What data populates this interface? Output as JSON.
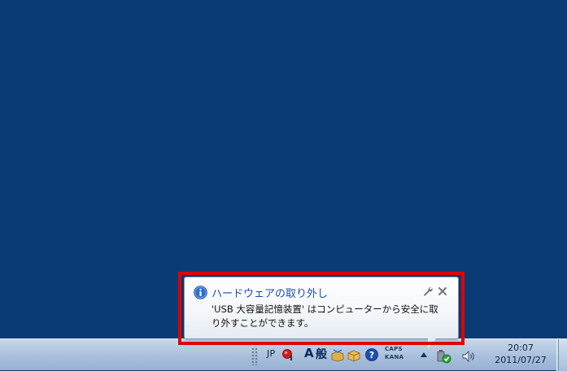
{
  "balloon": {
    "title": "ハードウェアの取り外し",
    "message": "'USB 大容量記憶装置' はコンピューターから安全に取り外すことができます。",
    "icon": "info-icon",
    "accent_color": "#1b4fb3"
  },
  "taskbar": {
    "language": "JP",
    "ime_mode": "A",
    "ime_kanji": "般",
    "caps_label": "CAPS",
    "kana_label": "KANA",
    "clock_time": "20:07",
    "clock_date": "2011/07/27"
  },
  "colors": {
    "desktop": "#0b3b74",
    "highlight": "#e00000"
  }
}
